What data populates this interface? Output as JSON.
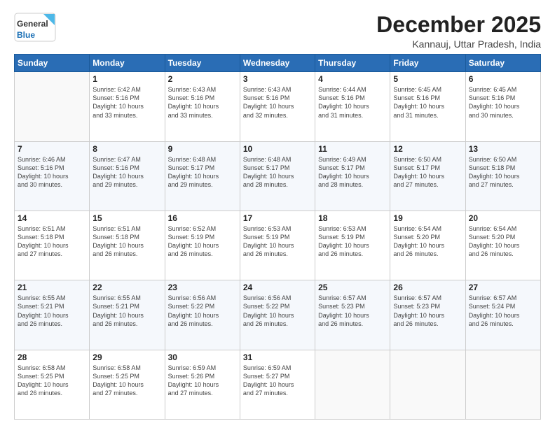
{
  "header": {
    "logo_line1": "General",
    "logo_line2": "Blue",
    "month": "December 2025",
    "location": "Kannauj, Uttar Pradesh, India"
  },
  "weekdays": [
    "Sunday",
    "Monday",
    "Tuesday",
    "Wednesday",
    "Thursday",
    "Friday",
    "Saturday"
  ],
  "weeks": [
    [
      {
        "day": "",
        "info": ""
      },
      {
        "day": "1",
        "info": "Sunrise: 6:42 AM\nSunset: 5:16 PM\nDaylight: 10 hours\nand 33 minutes."
      },
      {
        "day": "2",
        "info": "Sunrise: 6:43 AM\nSunset: 5:16 PM\nDaylight: 10 hours\nand 33 minutes."
      },
      {
        "day": "3",
        "info": "Sunrise: 6:43 AM\nSunset: 5:16 PM\nDaylight: 10 hours\nand 32 minutes."
      },
      {
        "day": "4",
        "info": "Sunrise: 6:44 AM\nSunset: 5:16 PM\nDaylight: 10 hours\nand 31 minutes."
      },
      {
        "day": "5",
        "info": "Sunrise: 6:45 AM\nSunset: 5:16 PM\nDaylight: 10 hours\nand 31 minutes."
      },
      {
        "day": "6",
        "info": "Sunrise: 6:45 AM\nSunset: 5:16 PM\nDaylight: 10 hours\nand 30 minutes."
      }
    ],
    [
      {
        "day": "7",
        "info": "Sunrise: 6:46 AM\nSunset: 5:16 PM\nDaylight: 10 hours\nand 30 minutes."
      },
      {
        "day": "8",
        "info": "Sunrise: 6:47 AM\nSunset: 5:16 PM\nDaylight: 10 hours\nand 29 minutes."
      },
      {
        "day": "9",
        "info": "Sunrise: 6:48 AM\nSunset: 5:17 PM\nDaylight: 10 hours\nand 29 minutes."
      },
      {
        "day": "10",
        "info": "Sunrise: 6:48 AM\nSunset: 5:17 PM\nDaylight: 10 hours\nand 28 minutes."
      },
      {
        "day": "11",
        "info": "Sunrise: 6:49 AM\nSunset: 5:17 PM\nDaylight: 10 hours\nand 28 minutes."
      },
      {
        "day": "12",
        "info": "Sunrise: 6:50 AM\nSunset: 5:17 PM\nDaylight: 10 hours\nand 27 minutes."
      },
      {
        "day": "13",
        "info": "Sunrise: 6:50 AM\nSunset: 5:18 PM\nDaylight: 10 hours\nand 27 minutes."
      }
    ],
    [
      {
        "day": "14",
        "info": "Sunrise: 6:51 AM\nSunset: 5:18 PM\nDaylight: 10 hours\nand 27 minutes."
      },
      {
        "day": "15",
        "info": "Sunrise: 6:51 AM\nSunset: 5:18 PM\nDaylight: 10 hours\nand 26 minutes."
      },
      {
        "day": "16",
        "info": "Sunrise: 6:52 AM\nSunset: 5:19 PM\nDaylight: 10 hours\nand 26 minutes."
      },
      {
        "day": "17",
        "info": "Sunrise: 6:53 AM\nSunset: 5:19 PM\nDaylight: 10 hours\nand 26 minutes."
      },
      {
        "day": "18",
        "info": "Sunrise: 6:53 AM\nSunset: 5:19 PM\nDaylight: 10 hours\nand 26 minutes."
      },
      {
        "day": "19",
        "info": "Sunrise: 6:54 AM\nSunset: 5:20 PM\nDaylight: 10 hours\nand 26 minutes."
      },
      {
        "day": "20",
        "info": "Sunrise: 6:54 AM\nSunset: 5:20 PM\nDaylight: 10 hours\nand 26 minutes."
      }
    ],
    [
      {
        "day": "21",
        "info": "Sunrise: 6:55 AM\nSunset: 5:21 PM\nDaylight: 10 hours\nand 26 minutes."
      },
      {
        "day": "22",
        "info": "Sunrise: 6:55 AM\nSunset: 5:21 PM\nDaylight: 10 hours\nand 26 minutes."
      },
      {
        "day": "23",
        "info": "Sunrise: 6:56 AM\nSunset: 5:22 PM\nDaylight: 10 hours\nand 26 minutes."
      },
      {
        "day": "24",
        "info": "Sunrise: 6:56 AM\nSunset: 5:22 PM\nDaylight: 10 hours\nand 26 minutes."
      },
      {
        "day": "25",
        "info": "Sunrise: 6:57 AM\nSunset: 5:23 PM\nDaylight: 10 hours\nand 26 minutes."
      },
      {
        "day": "26",
        "info": "Sunrise: 6:57 AM\nSunset: 5:23 PM\nDaylight: 10 hours\nand 26 minutes."
      },
      {
        "day": "27",
        "info": "Sunrise: 6:57 AM\nSunset: 5:24 PM\nDaylight: 10 hours\nand 26 minutes."
      }
    ],
    [
      {
        "day": "28",
        "info": "Sunrise: 6:58 AM\nSunset: 5:25 PM\nDaylight: 10 hours\nand 26 minutes."
      },
      {
        "day": "29",
        "info": "Sunrise: 6:58 AM\nSunset: 5:25 PM\nDaylight: 10 hours\nand 27 minutes."
      },
      {
        "day": "30",
        "info": "Sunrise: 6:59 AM\nSunset: 5:26 PM\nDaylight: 10 hours\nand 27 minutes."
      },
      {
        "day": "31",
        "info": "Sunrise: 6:59 AM\nSunset: 5:27 PM\nDaylight: 10 hours\nand 27 minutes."
      },
      {
        "day": "",
        "info": ""
      },
      {
        "day": "",
        "info": ""
      },
      {
        "day": "",
        "info": ""
      }
    ]
  ]
}
